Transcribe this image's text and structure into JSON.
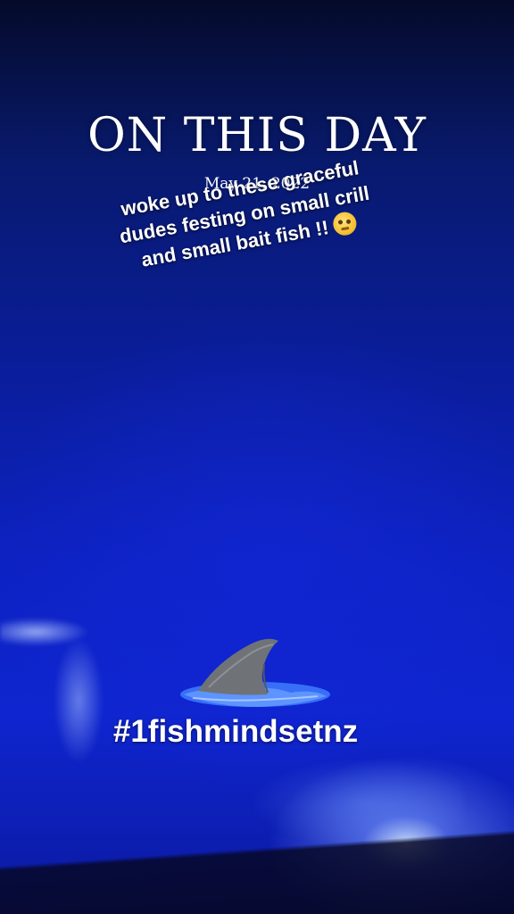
{
  "story": {
    "title": "ON THIS DAY",
    "date": "May 21, 2022",
    "caption_lines": [
      "woke up to these graceful",
      "dudes festing on small crill",
      "and small bait fish  !!"
    ],
    "caption_emoji": "face-with-monocle-emoji",
    "hashtag": "#1fishmindsetnz",
    "sticker": "shark-fin-sticker"
  },
  "colors": {
    "background_top": "#050a2a",
    "background_mid": "#0d22c2",
    "text": "#ffffff",
    "fin": "#6f7377",
    "water": "#3f7cff"
  }
}
